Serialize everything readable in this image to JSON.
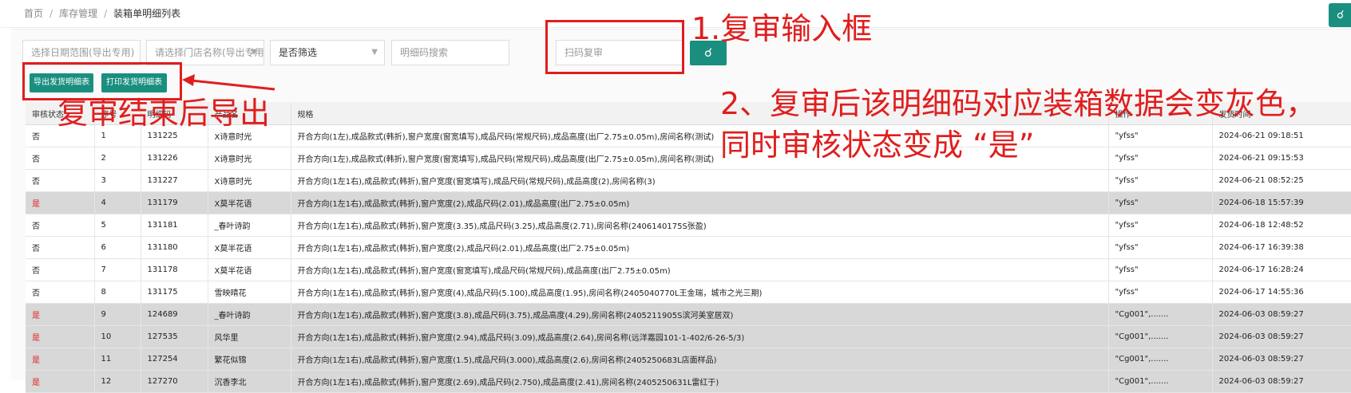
{
  "breadcrumb": [
    "首页",
    "库存管理",
    "装箱单明细列表"
  ],
  "filters": {
    "date_range": "选择日期范围(导出专用)",
    "store": "请选择门店名称(导出专用)",
    "screened": "是否筛选",
    "code_search": "明细码搜索",
    "scan_review": "扫码复审"
  },
  "icons": {
    "search": "search-icon",
    "corner": "search-icon"
  },
  "buttons": {
    "export": "导出发货明细表",
    "print": "打印发货明细表"
  },
  "table": {
    "columns": [
      "审核状态",
      "序号",
      "明细码",
      "产品名",
      "规格",
      "操作",
      "发货时间"
    ],
    "rows": [
      {
        "status": "否",
        "no": "1",
        "code": "131225",
        "product": "X诗意时光",
        "spec": "开合方向(1左),成品款式(韩折),窗户宽度(窗宽填写),成品尺码(常规尺码),成品高度(出厂2.75±0.05m),房间名称(测试)",
        "op": "\"yfss\"",
        "time": "2024-06-21 09:18:51",
        "gray": false
      },
      {
        "status": "否",
        "no": "2",
        "code": "131226",
        "product": "X诗意时光",
        "spec": "开合方向(1左),成品款式(韩折),窗户宽度(窗宽填写),成品尺码(常规尺码),成品高度(出厂2.75±0.05m),房间名称(测试)",
        "op": "\"yfss\"",
        "time": "2024-06-21 09:15:53",
        "gray": false
      },
      {
        "status": "否",
        "no": "3",
        "code": "131227",
        "product": "X诗意时光",
        "spec": "开合方向(1左1右),成品款式(韩折),窗户宽度(窗宽填写),成品尺码(常规尺码),成品高度(2),房间名称(3)",
        "op": "\"yfss\"",
        "time": "2024-06-21 08:52:25",
        "gray": false
      },
      {
        "status": "是",
        "no": "4",
        "code": "131179",
        "product": "X莫半花语",
        "spec": "开合方向(1左1右),成品款式(韩折),窗户宽度(2),成品尺码(2.01),成品高度(出厂2.75±0.05m)",
        "op": "\"yfss\"",
        "time": "2024-06-18 15:57:39",
        "gray": true
      },
      {
        "status": "否",
        "no": "5",
        "code": "131181",
        "product": "_春叶诗韵",
        "spec": "开合方向(1左1右),成品款式(韩折),窗户宽度(3.35),成品尺码(3.25),成品高度(2.71),房间名称(2406140175S张盈)",
        "op": "\"yfss\"",
        "time": "2024-06-18 12:48:52",
        "gray": false
      },
      {
        "status": "否",
        "no": "6",
        "code": "131180",
        "product": "X莫半花语",
        "spec": "开合方向(1左1右),成品款式(韩折),窗户宽度(2),成品尺码(2.01),成品高度(出厂2.75±0.05m)",
        "op": "\"yfss\"",
        "time": "2024-06-17 16:39:38",
        "gray": false
      },
      {
        "status": "否",
        "no": "7",
        "code": "131178",
        "product": "X莫半花语",
        "spec": "开合方向(1左1右),成品款式(韩折),窗户宽度(窗宽填写),成品尺码(常规尺码),成品高度(出厂2.75±0.05m)",
        "op": "\"yfss\"",
        "time": "2024-06-17 16:28:24",
        "gray": false
      },
      {
        "status": "否",
        "no": "8",
        "code": "131175",
        "product": "雪映晴花",
        "spec": "开合方向(1左1右),成品款式(韩折),窗户宽度(4),成品尺码(5.100),成品高度(1.95),房间名称(2405040770L王金瑞，城市之光三期)",
        "op": "\"yfss\"",
        "time": "2024-06-17 14:55:36",
        "gray": false
      },
      {
        "status": "是",
        "no": "9",
        "code": "124689",
        "product": "_春叶诗韵",
        "spec": "开合方向(1左1右),成品款式(韩折),窗户宽度(3.8),成品尺码(3.75),成品高度(4.29),房间名称(2405211905S滨河美室居双)",
        "op": "\"Cg001\",.......",
        "time": "2024-06-03 08:59:27",
        "gray": true
      },
      {
        "status": "是",
        "no": "10",
        "code": "127535",
        "product": "风华里",
        "spec": "开合方向(1左1右),成品款式(韩折),窗户宽度(2.94),成品尺码(3.09),成品高度(2.64),房间名称(远洋嘉园101-1-402/6-26-5/3)",
        "op": "\"Cg001\",.......",
        "time": "2024-06-03 08:59:27",
        "gray": true
      },
      {
        "status": "是",
        "no": "11",
        "code": "127254",
        "product": "繁花似锦",
        "spec": "开合方向(1左1右),成品款式(韩折),窗户宽度(1.5),成品尺码(3.000),成品高度(2.6),房间名称(2405250683L店面样品)",
        "op": "\"Cg001\",.......",
        "time": "2024-06-03 08:59:27",
        "gray": true
      },
      {
        "status": "是",
        "no": "12",
        "code": "127270",
        "product": "沉香李北",
        "spec": "开合方向(1左1右),成品款式(韩折),窗户宽度(2.69),成品尺码(2.750),成品高度(2.41),房间名称(2405250631L雷红于)",
        "op": "\"Cg001\",.......",
        "time": "2024-06-03 08:59:27",
        "gray": true
      }
    ]
  },
  "annotations": {
    "review_input": "1.复审输入框",
    "export_after": "复审结束后导出",
    "note_line1": "2、复审后该明细码对应装箱数据会变灰色，",
    "note_line2": "同时审核状态变成 “是”"
  },
  "colors": {
    "accent": "#1a8f7f",
    "annotation": "#e01e1e",
    "gray_row": "#d8d8d8"
  }
}
